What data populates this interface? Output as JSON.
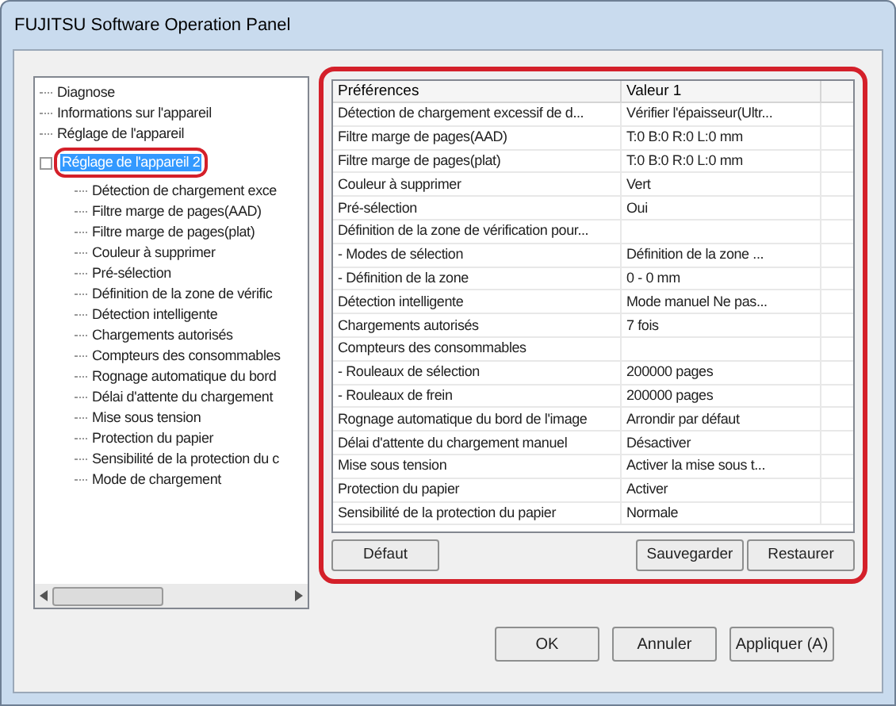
{
  "window": {
    "title": "FUJITSU Software Operation Panel"
  },
  "tree": {
    "items": [
      {
        "label": "Diagnose",
        "selected": false
      },
      {
        "label": "Informations sur l'appareil",
        "selected": false
      },
      {
        "label": "Réglage de l'appareil",
        "selected": false
      },
      {
        "label": "Réglage de l'appareil 2",
        "selected": true,
        "highlighted": true,
        "expanded": true,
        "children": [
          {
            "label": "Détection de chargement exce",
            "selected": false
          },
          {
            "label": "Filtre marge de pages(AAD)",
            "selected": false
          },
          {
            "label": "Filtre marge de pages(plat)",
            "selected": false
          },
          {
            "label": "Couleur à supprimer",
            "selected": false
          },
          {
            "label": "Pré-sélection",
            "selected": false
          },
          {
            "label": "Définition de la zone de vérific",
            "selected": false
          },
          {
            "label": "Détection intelligente",
            "selected": false
          },
          {
            "label": "Chargements autorisés",
            "selected": false
          },
          {
            "label": "Compteurs des consommables",
            "selected": false
          },
          {
            "label": "Rognage automatique du bord",
            "selected": false
          },
          {
            "label": "Délai d'attente du chargement",
            "selected": false
          },
          {
            "label": "Mise sous tension",
            "selected": false
          },
          {
            "label": "Protection du papier",
            "selected": false
          },
          {
            "label": "Sensibilité de la protection du c",
            "selected": false
          },
          {
            "label": "Mode de chargement",
            "selected": false
          }
        ]
      }
    ]
  },
  "panel": {
    "highlighted": true,
    "table": {
      "columns": [
        "Préférences",
        "Valeur 1"
      ],
      "rows": [
        [
          "Détection de chargement excessif de d...",
          "Vérifier l'épaisseur(Ultr..."
        ],
        [
          "Filtre marge de pages(AAD)",
          "T:0 B:0 R:0 L:0 mm"
        ],
        [
          "Filtre marge de pages(plat)",
          "T:0 B:0 R:0 L:0 mm"
        ],
        [
          "Couleur à supprimer",
          "Vert"
        ],
        [
          "Pré-sélection",
          "Oui"
        ],
        [
          "Définition de la zone de vérification pour...",
          ""
        ],
        [
          "- Modes de sélection",
          "Définition de la zone ..."
        ],
        [
          "- Définition de la zone",
          "0 - 0 mm"
        ],
        [
          "Détection intelligente",
          "Mode manuel  Ne pas..."
        ],
        [
          "Chargements autorisés",
          "7 fois"
        ],
        [
          "Compteurs des consommables",
          ""
        ],
        [
          "- Rouleaux de sélection",
          "200000 pages"
        ],
        [
          "- Rouleaux de frein",
          "200000 pages"
        ],
        [
          "Rognage automatique du bord de l'image",
          "Arrondir par défaut"
        ],
        [
          "Délai d'attente du chargement manuel",
          "Désactiver"
        ],
        [
          "Mise sous tension",
          "Activer la mise sous t..."
        ],
        [
          "Protection du papier",
          "Activer"
        ],
        [
          "Sensibilité de la protection du papier",
          "Normale"
        ]
      ]
    },
    "buttons": [
      "Défaut",
      "Sauvegarder",
      "Restaurer"
    ]
  },
  "buttons": [
    "OK",
    "Annuler",
    "Appliquer (A)"
  ]
}
